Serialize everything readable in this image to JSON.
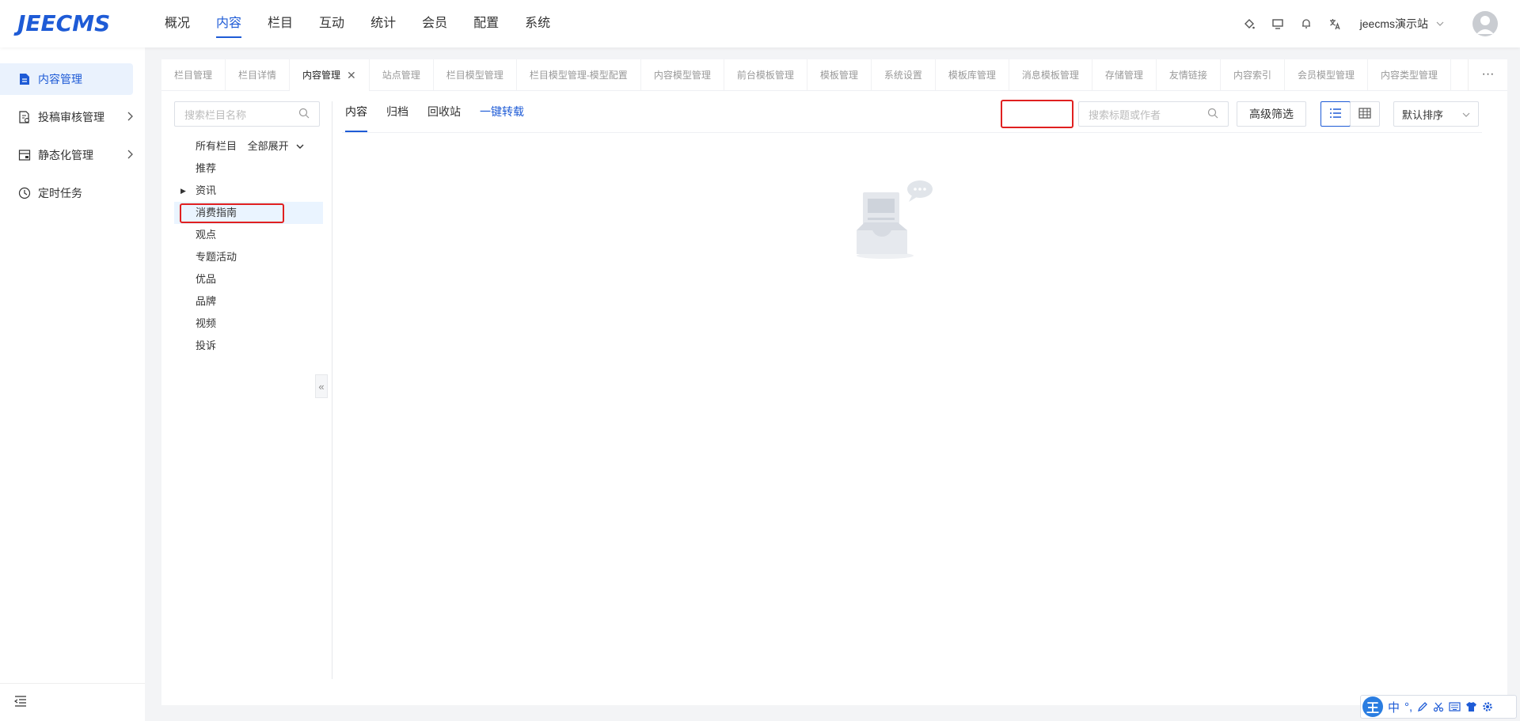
{
  "app": {
    "logo": "JEECMS"
  },
  "top_nav": {
    "items": [
      "概况",
      "内容",
      "栏目",
      "互动",
      "统计",
      "会员",
      "配置",
      "系统"
    ],
    "active": "内容"
  },
  "header_right": {
    "site_name": "jeecms演示站",
    "icons": [
      "skin-icon",
      "monitor-icon",
      "bell-icon",
      "translate-icon"
    ]
  },
  "sidebar": {
    "items": [
      {
        "label": "内容管理",
        "icon": "document-icon",
        "active": true
      },
      {
        "label": "投稿审核管理",
        "icon": "audit-icon",
        "has_children": true
      },
      {
        "label": "静态化管理",
        "icon": "static-icon",
        "has_children": true
      },
      {
        "label": "定时任务",
        "icon": "clock-icon"
      }
    ]
  },
  "tabs": {
    "items": [
      "栏目管理",
      "栏目详情",
      "内容管理",
      "站点管理",
      "栏目模型管理",
      "栏目模型管理-模型配置",
      "内容模型管理",
      "前台模板管理",
      "模板管理",
      "系统设置",
      "模板库管理",
      "消息模板管理",
      "存储管理",
      "友情链接",
      "内容索引",
      "会员模型管理",
      "内容类型管理"
    ],
    "active": "内容管理",
    "more": "···"
  },
  "tree": {
    "search_placeholder": "搜索栏目名称",
    "header": "所有栏目",
    "expand_all": "全部展开",
    "nodes": [
      "推荐",
      "资讯",
      "消费指南",
      "观点",
      "专题活动",
      "优品",
      "品牌",
      "视频",
      "投诉"
    ],
    "selected": "消费指南",
    "collapse_glyph": "«"
  },
  "content_tabs": {
    "items": [
      "内容",
      "归档",
      "回收站"
    ],
    "active": "内容",
    "link": "一键转载"
  },
  "toolbar": {
    "search_placeholder": "搜索标题或作者",
    "advanced_filter": "高级筛选",
    "sort_value": "默认排序"
  },
  "ime": {
    "logo": "王",
    "mode": "中",
    "punct": "°,"
  },
  "colors": {
    "brand": "#1e5bd6",
    "highlight_box": "#e02020",
    "selected_bg": "#eaf4ff"
  }
}
